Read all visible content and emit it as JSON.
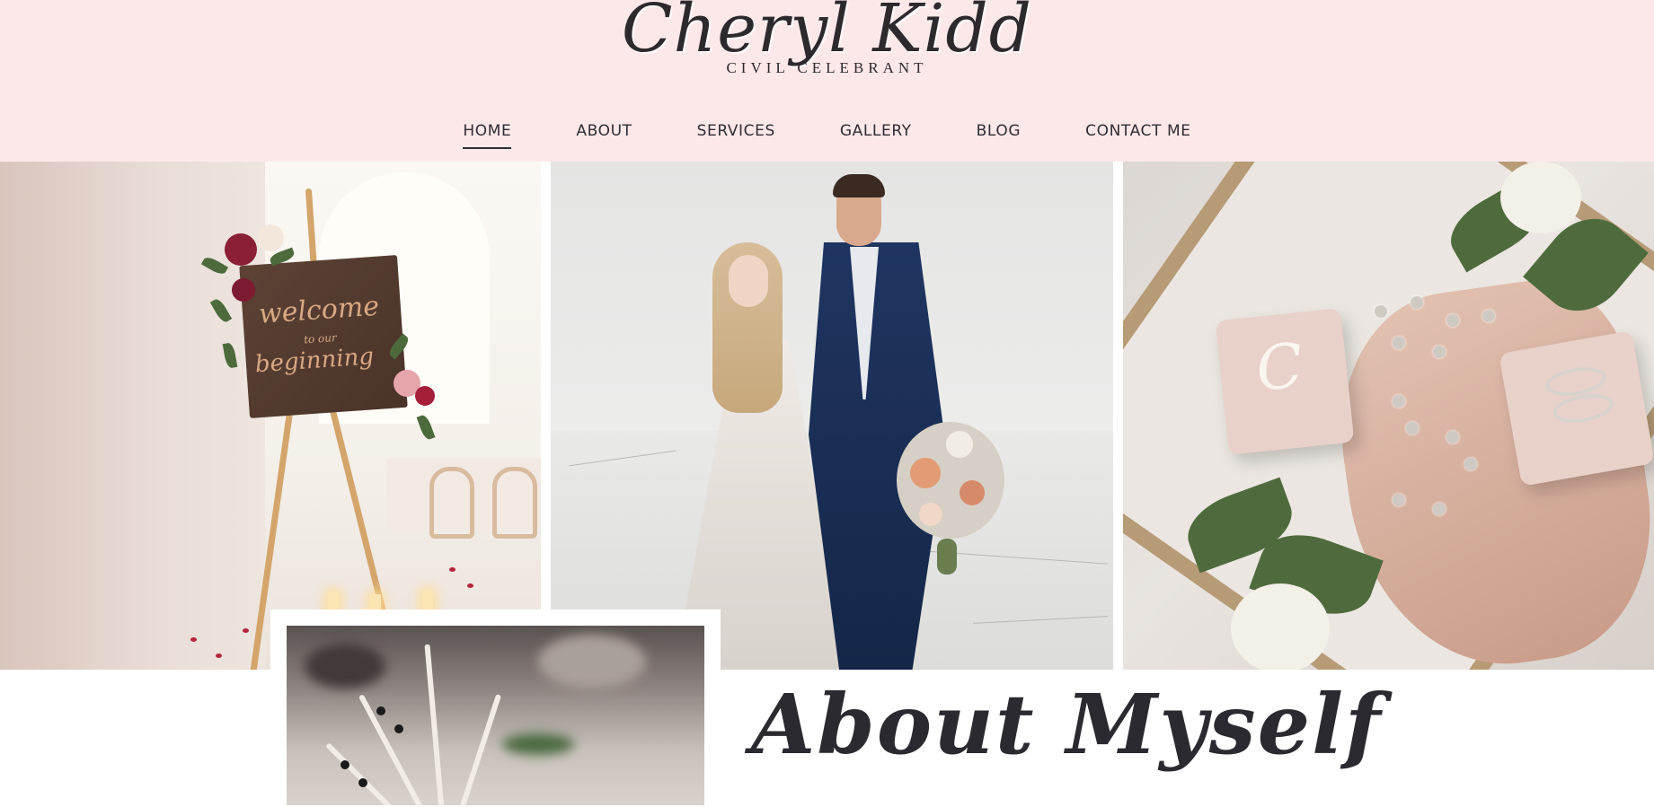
{
  "brand": {
    "name": "Cheryl Kidd",
    "tagline": "CIVIL CELEBRANT"
  },
  "nav": {
    "items": [
      {
        "label": "HOME",
        "active": true
      },
      {
        "label": "ABOUT",
        "active": false
      },
      {
        "label": "SERVICES",
        "active": false
      },
      {
        "label": "GALLERY",
        "active": false
      },
      {
        "label": "BLOG",
        "active": false
      },
      {
        "label": "CONTACT ME",
        "active": false
      }
    ]
  },
  "hero": {
    "sign_text": {
      "line1": "welcome",
      "line2": "to our",
      "line3": "beginning"
    },
    "ring_box_monogram": "C"
  },
  "about": {
    "title": "About Myself"
  },
  "colors": {
    "header_bg": "#fde8e9",
    "text_dark": "#2e2d33",
    "page_bg": "#ffffff"
  }
}
